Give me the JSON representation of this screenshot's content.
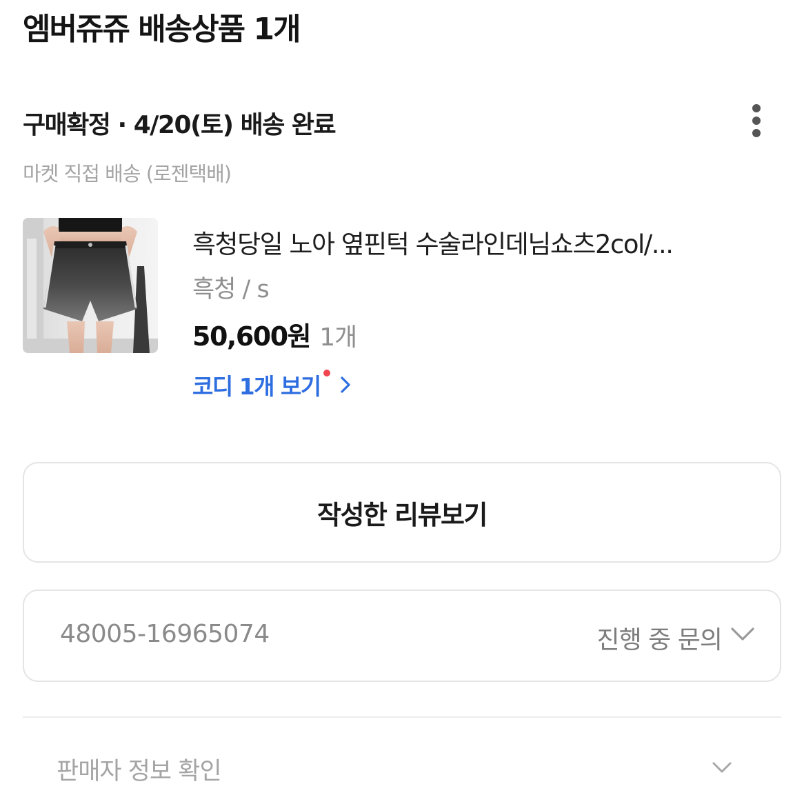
{
  "header": {
    "store_title": "엠버쥬쥬 배송상품 1개"
  },
  "order": {
    "status": "구매확정 · 4/20(토) 배송 완료",
    "menu_icon": "more-vertical-icon",
    "shipping_method": "마켓 직접 배송 (로젠택배)"
  },
  "product": {
    "name": "흑청당일 노아 옆핀턱 수술라인데님쇼츠2col/...",
    "option": "흑청 / s",
    "price": "50,600원",
    "quantity": "1개",
    "codi_link_label": "코디 1개 보기",
    "codi_chevron_icon": "chevron-right-icon",
    "codi_link_color": "#2f6ee0",
    "new_dot_color": "#f0464f"
  },
  "actions": {
    "review_button_label": "작성한 리뷰보기"
  },
  "inquiry": {
    "order_number": "48005-16965074",
    "status_label": "진행 중 문의",
    "chevron_icon": "chevron-down-icon"
  },
  "seller": {
    "label": "판매자 정보 확인",
    "chevron_icon": "chevron-down-icon"
  }
}
